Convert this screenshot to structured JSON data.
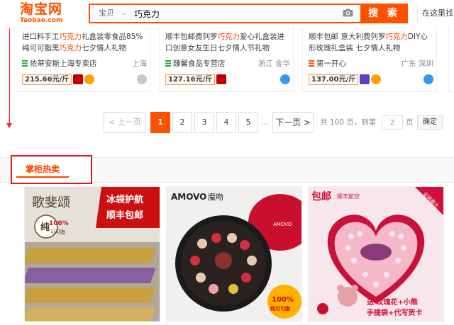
{
  "header": {
    "logo_main": "淘宝网",
    "logo_sub": "Taobao.com",
    "search_type": "宝贝",
    "search_value": "巧克力",
    "search_button": "搜 索",
    "store_search": "在这里找"
  },
  "cards": [
    {
      "title_pre": "进口料手工",
      "title_hl1": "巧克力",
      "title_mid": "礼盒装零食品85%纯可可脂黑",
      "title_hl2": "巧克力",
      "title_post": "七夕情人礼物",
      "shop": "依蒂安斯上海专卖店",
      "location": "上海",
      "price": "215.66元/斤",
      "colors": {
        "shop_icon": "#22aa44"
      }
    },
    {
      "title_pre": "顺丰包邮费列罗",
      "title_hl1": "巧克力",
      "title_mid": "爱心礼盒装进口创意女友生日七夕情人节礼物",
      "title_hl2": "",
      "title_post": "",
      "shop": "臻馨食品专营店",
      "location": "浙江 金华",
      "price": "127.16元/斤",
      "colors": {
        "shop_icon": "#22aa44"
      }
    },
    {
      "title_pre": "顺丰包邮 意大利费列罗",
      "title_hl1": "巧克力",
      "title_mid": "DIY心形玫瑰礼盒装 七夕情人礼物",
      "title_hl2": "",
      "title_post": "",
      "shop": "第一开心",
      "location": "广东 深圳",
      "price": "137.00元/斤",
      "colors": {
        "shop_icon": "#ff4400"
      }
    }
  ],
  "pagination": {
    "prev": "< 上一页",
    "pages": [
      "1",
      "2",
      "3",
      "4",
      "5"
    ],
    "active_page": "1",
    "ellipsis": "...",
    "next": "下一页 >",
    "total": "共 100 页，到第",
    "goto_value": "2",
    "page_label": "页",
    "confirm": "确定"
  },
  "hot_sale": {
    "tab_label": "掌柜热卖"
  },
  "products": [
    {
      "brand_text": "歌斐颂",
      "badge_main": "纯",
      "badge_pct": "100%",
      "badge_sub": "可可脂",
      "banner_line1": "冰袋护航",
      "banner_line2": "顺丰包邮"
    },
    {
      "brand_text": "AMOVO",
      "brand_suffix": "魔吻",
      "box_text": "AMOVO",
      "badge_pct": "100%",
      "badge_sub": "纯可可脂"
    },
    {
      "banner_main": "包邮",
      "banner_sub": "顺丰航空",
      "corner": "全网最大",
      "promo_line1": "送 玫瑰花+小熊",
      "promo_line2": "手提袋+代写贺卡"
    }
  ],
  "colors": {
    "accent": "#ff5000",
    "highlight": "#ff4400",
    "guide_red": "#e01818"
  }
}
